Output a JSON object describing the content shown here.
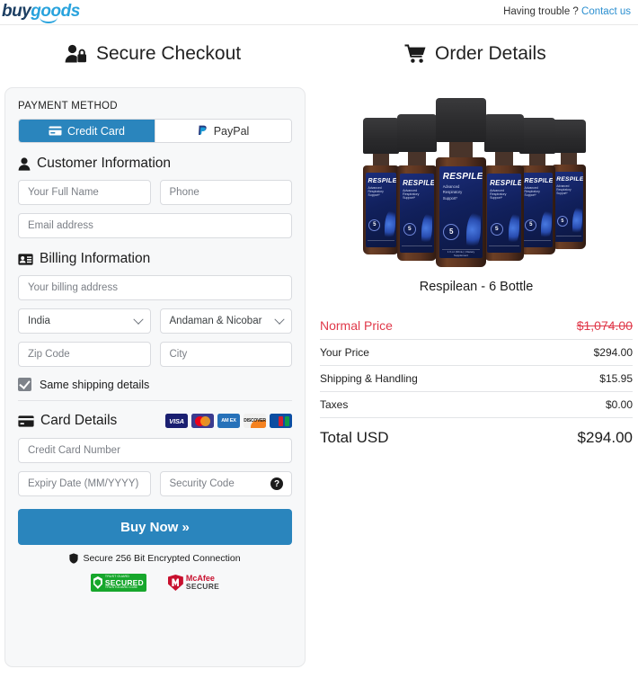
{
  "topbar": {
    "logo_part1": "buy",
    "logo_part2": "goods",
    "help_text": "Having trouble ?",
    "contact_link": "Contact us"
  },
  "headings": {
    "checkout": "Secure Checkout",
    "order": "Order Details"
  },
  "payment": {
    "section_label": "PAYMENT METHOD",
    "tabs": [
      {
        "label": "Credit Card",
        "icon": "credit-card-icon",
        "active": true
      },
      {
        "label": "PayPal",
        "icon": "paypal-icon",
        "active": false
      }
    ]
  },
  "customer": {
    "heading": "Customer Information",
    "full_name_placeholder": "Your Full Name",
    "phone_placeholder": "Phone",
    "email_placeholder": "Email address"
  },
  "billing": {
    "heading": "Billing Information",
    "address_placeholder": "Your billing address",
    "country_value": "India",
    "state_value": "Andaman & Nicobar",
    "zip_placeholder": "Zip Code",
    "city_placeholder": "City",
    "same_shipping_label": "Same shipping details",
    "same_shipping_checked": true
  },
  "card": {
    "heading": "Card Details",
    "brands": [
      "VISA",
      "Mastercard",
      "AMEX",
      "DISCOVER",
      "JCB"
    ],
    "brand_labels": {
      "visa": "VISA",
      "amex": "AM EX",
      "discover": "DISCOVER",
      "jcb": "JCB"
    },
    "number_placeholder": "Credit Card Number",
    "expiry_placeholder": "Expiry Date (MM/YYYY)",
    "security_placeholder": "Security Code",
    "security_help_glyph": "?"
  },
  "submit": {
    "buy_label": "Buy Now »",
    "secure_note": "Secure 256 Bit Encrypted Connection",
    "badges": [
      {
        "name": "trustedsite-secured-badge",
        "small": "TRUST GUARD",
        "big": "SECURED",
        "tiny": "TRUSTGUARD.COM"
      },
      {
        "name": "mcafee-secure-badge",
        "line1": "McAfee",
        "line2": "SECURE"
      }
    ]
  },
  "order": {
    "product_title": "Respilean - 6 Bottle",
    "bottle_label_name": "RESPILEAN",
    "bottle_label_sub": "Advanced Respiratory Support*",
    "bottle_label_number": "5",
    "bottle_label_foot": "1 fl oz (30mL) | Dietary Supplement",
    "bottle_count": 6,
    "price_rows": [
      {
        "label": "Normal Price",
        "value": "$1,074.00",
        "style": "strike-red"
      },
      {
        "label": "Your Price",
        "value": "$294.00",
        "style": "normal"
      },
      {
        "label": "Shipping & Handling",
        "value": "$15.95",
        "style": "normal"
      },
      {
        "label": "Taxes",
        "value": "$0.00",
        "style": "normal"
      },
      {
        "label": "Total USD",
        "value": "$294.00",
        "style": "total"
      }
    ]
  },
  "colors": {
    "accent_blue": "#2a85bd",
    "link_blue": "#2b8fd0",
    "sale_red": "#e0394a",
    "logo_navy": "#1d3f63",
    "logo_blue": "#29a3dd",
    "card_bg": "#f7f8f9"
  }
}
